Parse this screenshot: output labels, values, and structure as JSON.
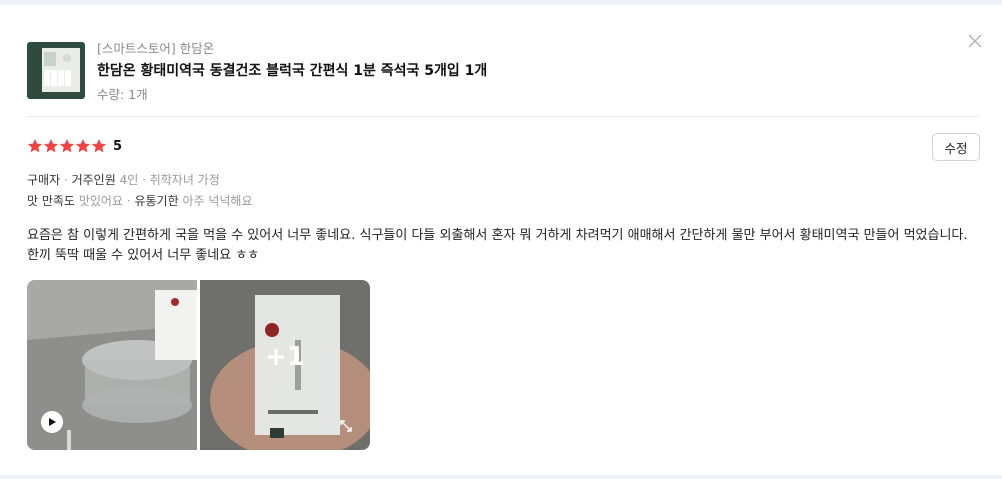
{
  "product": {
    "store": "[스마트스토어] 한담온",
    "title": "한담온 황태미역국 동결건조 블럭국 간편식 1분 즉석국 5개입 1개",
    "quantity": "수량: 1개"
  },
  "review": {
    "rating": 5,
    "rating_label": "5",
    "edit_label": "수정",
    "meta1_label": "구매자",
    "meta1_key": "거주인원",
    "meta1_value": "4인 · 취학자녀 가정",
    "meta2_key1": "맛 만족도",
    "meta2_val1": "맛있어요",
    "meta2_key2": "유통기한",
    "meta2_val2": "아주 넉넉해요",
    "text": "요즘은 참 이렇게 간편하게 국을 먹을 수 있어서 너무 좋네요. 식구들이 다들 외출해서 혼자 뭐 거하게 차려먹기 애매해서 간단하게 물만 부어서 황태미역국 만들어 먹었습니다. 한끼 뚝딱 때울 수 있어서 너무 좋네요 ㅎㅎ",
    "photo_more": "+1"
  },
  "icons": {
    "close": "close-icon",
    "star": "star-icon",
    "play": "play-icon",
    "expand": "expand-icon"
  },
  "colors": {
    "star": "#f24343",
    "accent_text": "#111111",
    "muted_text": "#999999"
  }
}
